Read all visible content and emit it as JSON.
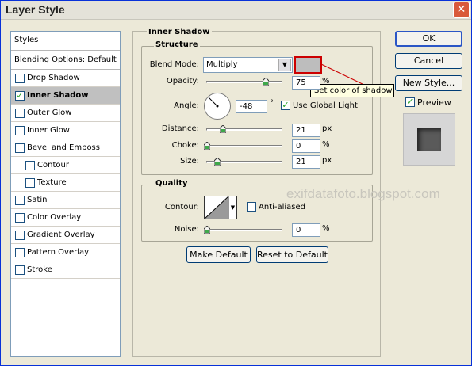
{
  "window": {
    "title": "Layer Style"
  },
  "styles": {
    "header": "Styles",
    "blending": "Blending Options: Default",
    "items": [
      {
        "label": "Drop Shadow",
        "checked": false,
        "sub": false,
        "selected": false
      },
      {
        "label": "Inner Shadow",
        "checked": true,
        "sub": false,
        "selected": true
      },
      {
        "label": "Outer Glow",
        "checked": false,
        "sub": false,
        "selected": false
      },
      {
        "label": "Inner Glow",
        "checked": false,
        "sub": false,
        "selected": false
      },
      {
        "label": "Bevel and Emboss",
        "checked": false,
        "sub": false,
        "selected": false
      },
      {
        "label": "Contour",
        "checked": false,
        "sub": true,
        "selected": false
      },
      {
        "label": "Texture",
        "checked": false,
        "sub": true,
        "selected": false
      },
      {
        "label": "Satin",
        "checked": false,
        "sub": false,
        "selected": false
      },
      {
        "label": "Color Overlay",
        "checked": false,
        "sub": false,
        "selected": false
      },
      {
        "label": "Gradient Overlay",
        "checked": false,
        "sub": false,
        "selected": false
      },
      {
        "label": "Pattern Overlay",
        "checked": false,
        "sub": false,
        "selected": false
      },
      {
        "label": "Stroke",
        "checked": false,
        "sub": false,
        "selected": false
      }
    ]
  },
  "inner_shadow": {
    "title": "Inner Shadow",
    "structure": {
      "title": "Structure",
      "blend_mode_label": "Blend Mode:",
      "blend_mode_value": "Multiply",
      "shadow_color": "#bdbdbd",
      "tooltip": "Set color of shadow",
      "opacity_label": "Opacity:",
      "opacity_value": "75",
      "opacity_unit": "%",
      "angle_label": "Angle:",
      "angle_value": "-48",
      "angle_unit": "°",
      "global_light_label": "Use Global Light",
      "global_light_checked": true,
      "distance_label": "Distance:",
      "distance_value": "21",
      "distance_unit": "px",
      "choke_label": "Choke:",
      "choke_value": "0",
      "choke_unit": "%",
      "size_label": "Size:",
      "size_value": "21",
      "size_unit": "px"
    },
    "quality": {
      "title": "Quality",
      "contour_label": "Contour:",
      "anti_aliased_label": "Anti-aliased",
      "anti_aliased_checked": false,
      "noise_label": "Noise:",
      "noise_value": "0",
      "noise_unit": "%"
    },
    "make_default": "Make Default",
    "reset_default": "Reset to Default"
  },
  "buttons": {
    "ok": "OK",
    "cancel": "Cancel",
    "new_style": "New Style...",
    "preview_label": "Preview",
    "preview_checked": true
  },
  "watermark": "exifdatafoto.blogspot.com"
}
